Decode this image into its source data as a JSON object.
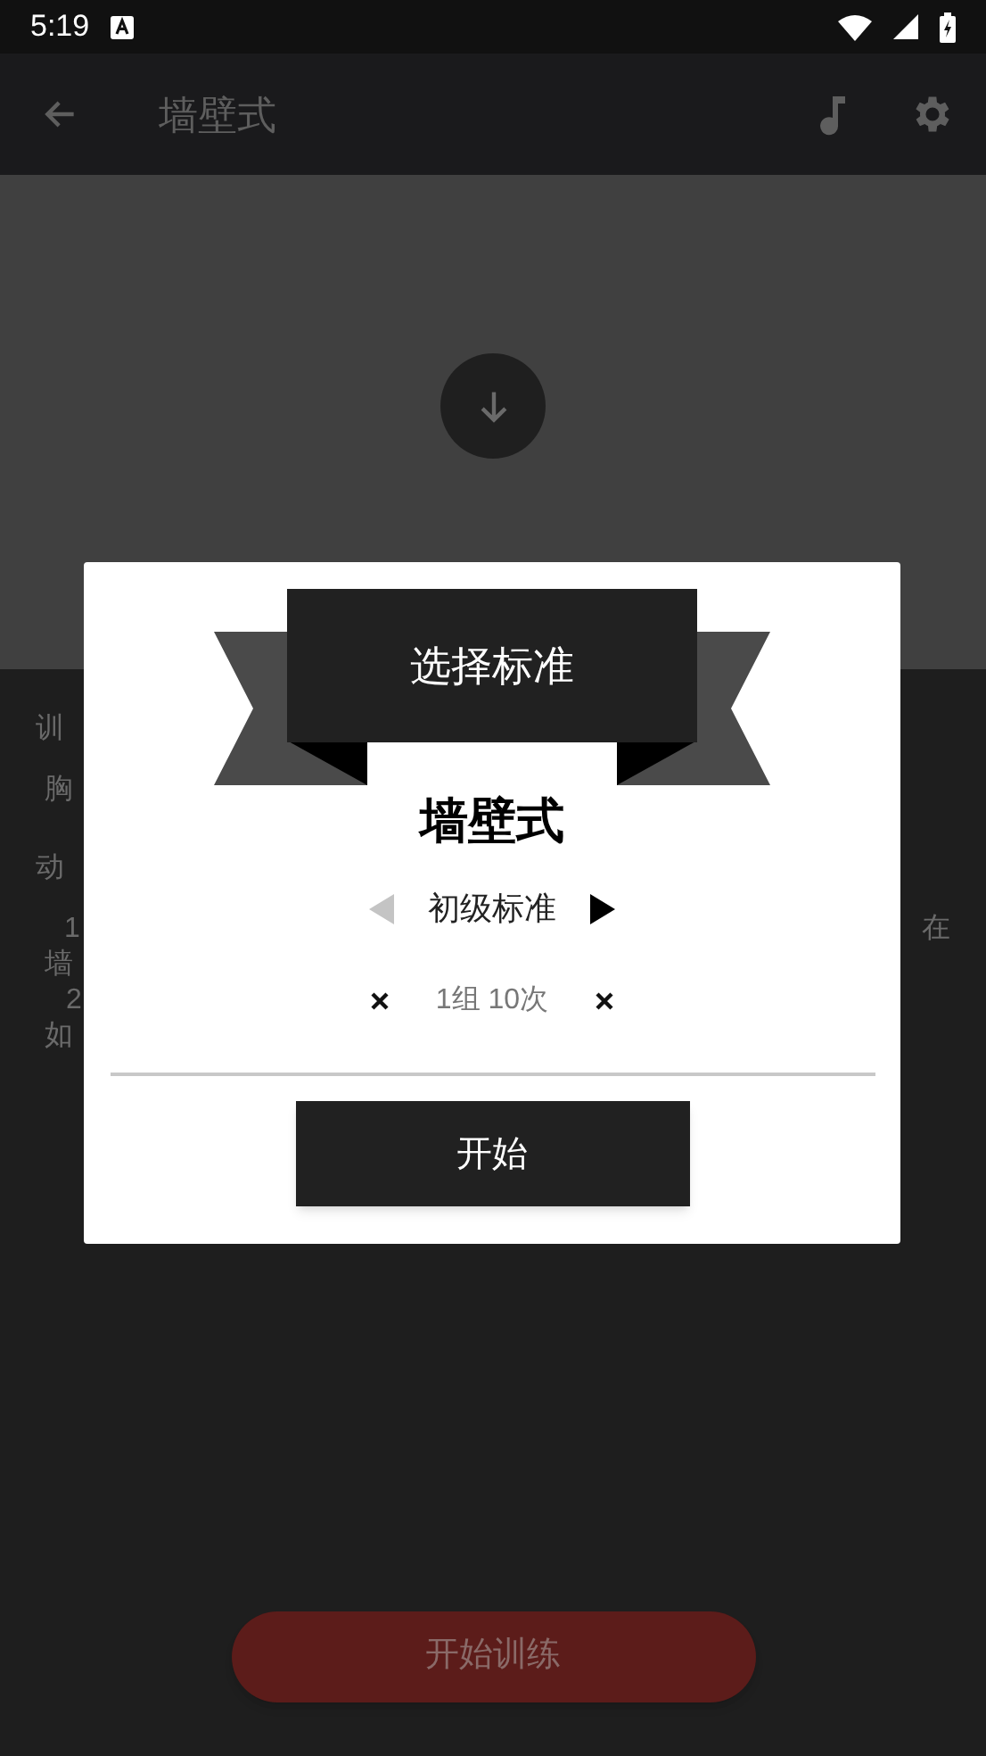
{
  "status_bar": {
    "time": "5:19"
  },
  "app_bar": {
    "title": "墙壁式"
  },
  "background_lines": [
    [
      "训"
    ],
    [
      "胸"
    ],
    [
      "动"
    ],
    [
      "1",
      "在"
    ],
    [
      "墙"
    ],
    [
      "2"
    ],
    [
      "如"
    ]
  ],
  "start_training_button": {
    "label": "开始训练"
  },
  "dialog": {
    "ribbon_title": "选择标准",
    "exercise_name": "墙壁式",
    "level": {
      "label": "初级标准",
      "prev_enabled": false,
      "next_enabled": true
    },
    "sets": "1组 10次",
    "start_button": "开始"
  }
}
